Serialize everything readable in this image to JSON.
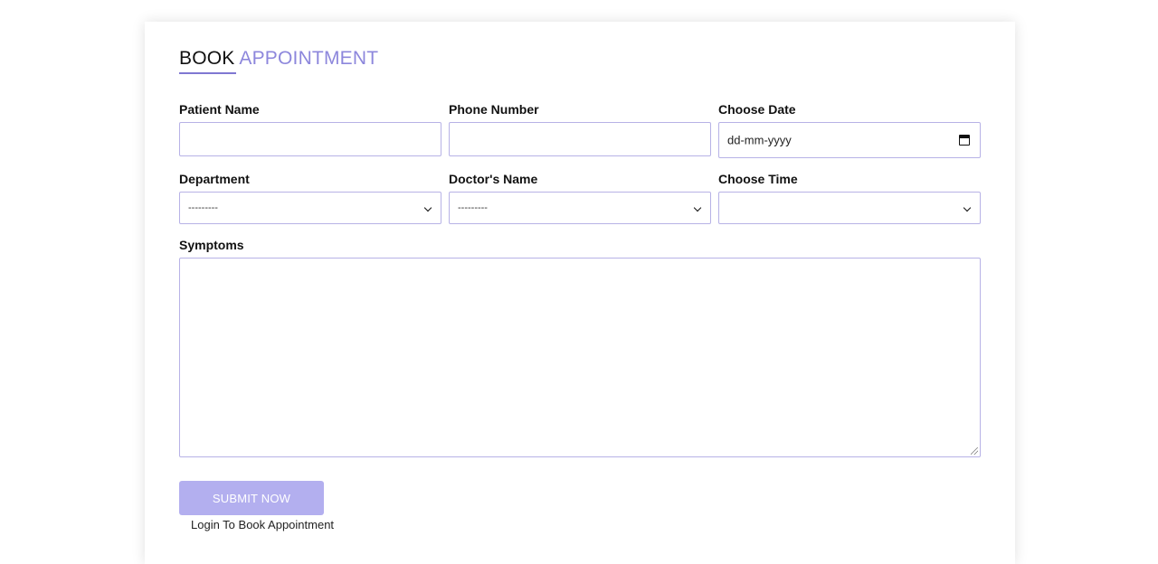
{
  "form": {
    "title_part1": "BOOK",
    "title_part2": "APPOINTMENT",
    "patient_name": {
      "label": "Patient Name",
      "value": ""
    },
    "phone_number": {
      "label": "Phone Number",
      "value": ""
    },
    "choose_date": {
      "label": "Choose Date",
      "placeholder": "dd-mm-yyyy"
    },
    "department": {
      "label": "Department",
      "selected": "---------"
    },
    "doctor_name": {
      "label": "Doctor's Name",
      "selected": "---------"
    },
    "choose_time": {
      "label": "Choose Time",
      "selected": ""
    },
    "symptoms": {
      "label": "Symptoms",
      "value": ""
    },
    "submit_label": "SUBMIT NOW",
    "login_link": "Login To Book Appointment"
  },
  "colors": {
    "accent": "#8d87dc",
    "button": "#b3afef",
    "field_border": "#b7b2e6"
  },
  "icons": [
    "calendar-icon",
    "chevron-down-icon",
    "resize-handle-icon"
  ]
}
